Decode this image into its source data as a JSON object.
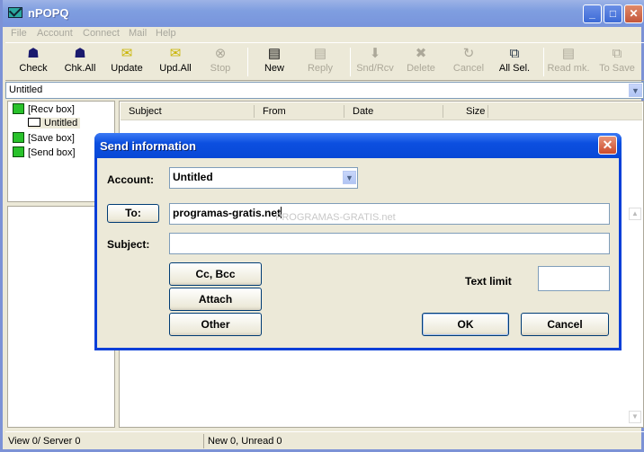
{
  "window": {
    "title": "nPOPQ",
    "min": "_",
    "max": "□",
    "close": "✕"
  },
  "menu": [
    "File",
    "Account",
    "Connect",
    "Mail",
    "Help"
  ],
  "toolbar": [
    {
      "label": "Check",
      "icon": "check-mail-icon",
      "enabled": true
    },
    {
      "label": "Chk.All",
      "icon": "check-all-icon",
      "enabled": true
    },
    {
      "label": "Update",
      "icon": "update-icon",
      "enabled": true
    },
    {
      "label": "Upd.All",
      "icon": "update-all-icon",
      "enabled": true
    },
    {
      "label": "Stop",
      "icon": "stop-icon",
      "enabled": false
    },
    {
      "label": "New",
      "icon": "new-mail-icon",
      "enabled": true
    },
    {
      "label": "Reply",
      "icon": "reply-icon",
      "enabled": false
    },
    {
      "label": "Snd/Rcv",
      "icon": "send-receive-icon",
      "enabled": false
    },
    {
      "label": "Delete",
      "icon": "delete-icon",
      "enabled": false
    },
    {
      "label": "Cancel",
      "icon": "cancel-icon",
      "enabled": false
    },
    {
      "label": "All Sel.",
      "icon": "select-all-icon",
      "enabled": true
    },
    {
      "label": "Read mk.",
      "icon": "read-mark-icon",
      "enabled": false
    },
    {
      "label": "To Save",
      "icon": "to-save-icon",
      "enabled": false
    }
  ],
  "account_selector": {
    "value": "Untitled"
  },
  "tree": {
    "recv": "[Recv box]",
    "account": "Untitled",
    "save": "[Save box]",
    "send": "[Send box]"
  },
  "list": {
    "columns": [
      "Subject",
      "From",
      "Date",
      "Size"
    ]
  },
  "status": {
    "left": "View 0/ Server 0",
    "right": "New 0, Unread 0"
  },
  "watermark": "PROGRAMAS-GRATIS.net",
  "dialog": {
    "title": "Send information",
    "account_label": "Account:",
    "account_value": "Untitled",
    "to_button": "To:",
    "to_value": "programas-gratis.net",
    "subject_label": "Subject:",
    "subject_value": "",
    "cc_button": "Cc, Bcc",
    "attach_button": "Attach",
    "other_button": "Other",
    "text_limit_label": "Text limit",
    "text_limit_value": "",
    "ok_button": "OK",
    "cancel_button": "Cancel"
  }
}
